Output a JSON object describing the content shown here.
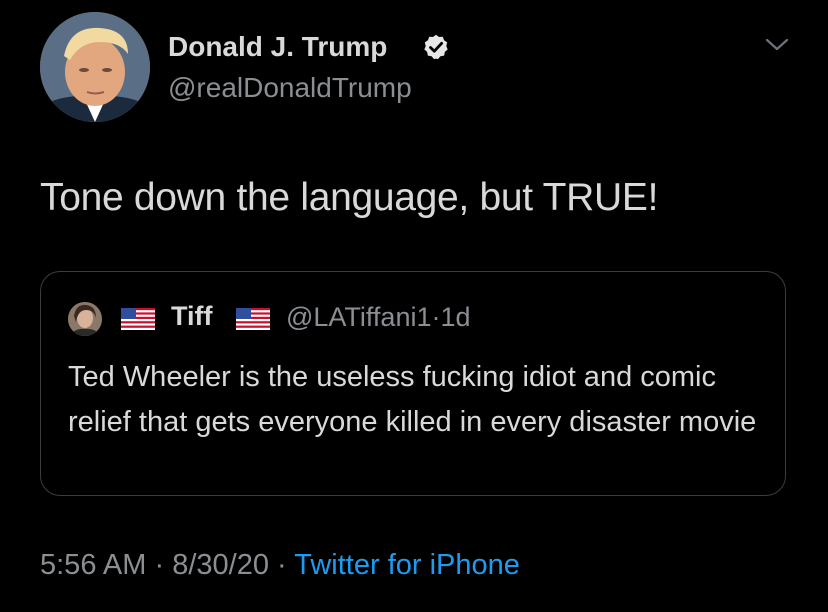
{
  "author": {
    "name": "Donald J. Trump",
    "handle": "@realDonaldTrump",
    "verified_icon": "verified-badge-icon",
    "avatar": "avatar"
  },
  "menu_icon": "chevron-down-icon",
  "tweet": {
    "text": "Tone down the language, but TRUE!"
  },
  "quoted_tweet": {
    "name": "Tiff",
    "handle": "@LATiffani1",
    "separator": "·",
    "age": "1d",
    "text": "Ted Wheeler is the useless fucking  idiot and comic relief that gets everyone killed in every disaster movie",
    "name_emoji": "us-flag-icon"
  },
  "footer": {
    "time": "5:56 AM",
    "sep1": "·",
    "date": "8/30/20",
    "sep2": "·",
    "source": "Twitter for iPhone"
  },
  "colors": {
    "background": "#000000",
    "text": "#d9d9d9",
    "secondary": "#8b8f94",
    "link": "#1d9bf0",
    "border": "#3a3d41"
  }
}
